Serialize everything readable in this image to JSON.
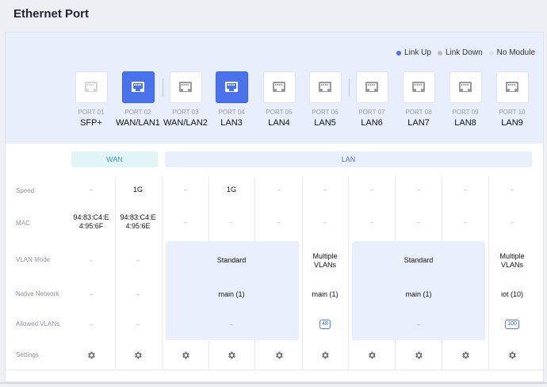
{
  "page": {
    "title": "Ethernet Port"
  },
  "legend": [
    {
      "label": "Link Up",
      "color": "#4a72ea"
    },
    {
      "label": "Link Down",
      "color": "#bdbdbd"
    },
    {
      "label": "No Module",
      "color": "#e2e2e2"
    }
  ],
  "ports": [
    {
      "num": "PORT 01",
      "name": "SFP+",
      "state": "no-module",
      "speed": "–",
      "mac": "94:83:C4:E\n4:95:6F",
      "vlan_mode": "–",
      "native": "–",
      "allowed": "–"
    },
    {
      "num": "PORT 02",
      "name": "WAN/LAN1",
      "state": "link-up",
      "speed": "1G",
      "mac": "94:83:C4:E\n4:95:6E",
      "vlan_mode": "–",
      "native": "–",
      "allowed": "–"
    },
    {
      "num": "PORT 03",
      "name": "WAN/LAN2",
      "state": "link-down",
      "speed": "–",
      "mac": "–"
    },
    {
      "num": "PORT 04",
      "name": "LAN3",
      "state": "link-up",
      "speed": "1G",
      "mac": "–"
    },
    {
      "num": "PORT 05",
      "name": "LAN4",
      "state": "link-down",
      "speed": "–",
      "mac": "–"
    },
    {
      "num": "PORT 06",
      "name": "LAN5",
      "state": "link-down",
      "speed": "–",
      "mac": "–"
    },
    {
      "num": "PORT 07",
      "name": "LAN6",
      "state": "link-down",
      "speed": "–",
      "mac": "–"
    },
    {
      "num": "PORT 08",
      "name": "LAN7",
      "state": "link-down",
      "speed": "–",
      "mac": "–"
    },
    {
      "num": "PORT 09",
      "name": "LAN8",
      "state": "link-down",
      "speed": "–",
      "mac": "–"
    },
    {
      "num": "PORT 10",
      "name": "LAN9",
      "state": "link-down",
      "speed": "–",
      "mac": "–"
    }
  ],
  "bands": {
    "wan": "WAN",
    "lan": "LAN"
  },
  "rows": {
    "speed": "Speed",
    "mac": "MAC",
    "vlan_mode": "VLAN Mode",
    "native_network": "Native Network",
    "allowed_vlans": "Allowed VLANs",
    "settings": "Settings"
  },
  "vlan_groups": [
    {
      "mode": "Standard",
      "native": "main (1)",
      "allowed": "–"
    },
    {
      "mode": "Multiple\nVLANs",
      "native": "main (1)",
      "allowed": "48"
    },
    {
      "mode": "Standard",
      "native": "main (1)",
      "allowed": "–"
    },
    {
      "mode": "Multiple\nVLANs",
      "native": "iot (10)",
      "allowed": "100"
    }
  ],
  "icons": {
    "port": "ethernet-port-icon",
    "settings": "gear-icon"
  }
}
